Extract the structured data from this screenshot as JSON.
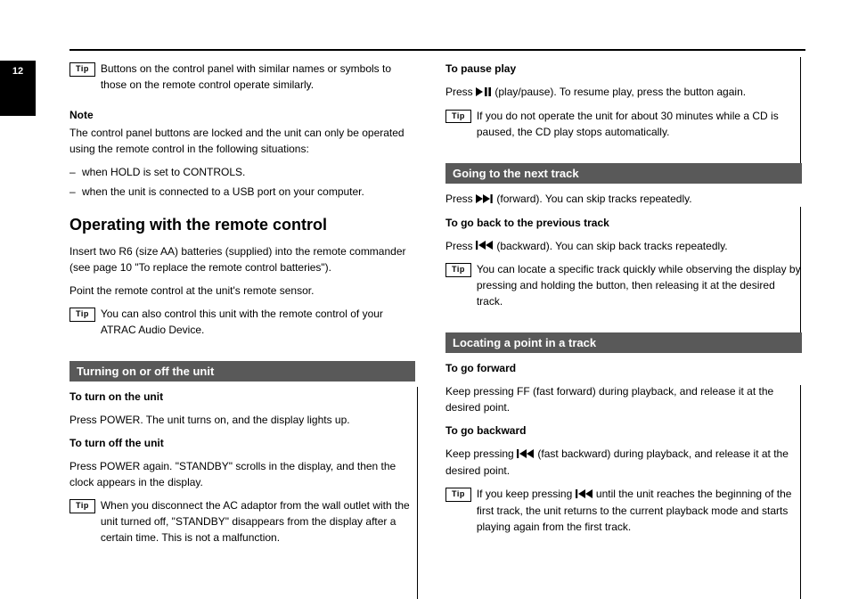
{
  "page_number": "12",
  "left": {
    "tip1": {
      "label": "Tip",
      "body": "Buttons on the control panel with similar names or symbols to those on the remote control operate similarly."
    },
    "note1": {
      "label": "Note",
      "body": "The control panel buttons are locked and the unit can only be operated using the remote control in the following situations:",
      "bullets": [
        "when HOLD is set to CONTROLS.",
        "when the unit is connected to a USB port on your computer."
      ]
    },
    "remote_heading": "Operating with the remote control",
    "remote_p1": "Insert two R6 (size AA) batteries (supplied) into the remote commander (see page 10 \"To replace the remote control batteries\").",
    "remote_p2": "Point the remote control at the unit's remote sensor.",
    "tip2": {
      "label": "Tip",
      "body": "You can also control this unit with the remote control of your ATRAC Audio Device."
    },
    "section_power_title": "Turning on or off the unit",
    "power_on_h": "To turn on the unit",
    "power_on_b": "Press POWER. The unit turns on, and the display lights up.",
    "power_off_h": "To turn off the unit",
    "power_off_b": "Press POWER again. \"STANDBY\" scrolls in the display, and then the clock appears in the display.",
    "tip3": {
      "label": "Tip",
      "body": "When you disconnect the AC adaptor from the wall outlet with the unit turned off, \"STANDBY\" disappears from the display after a certain time. This is not a malfunction."
    }
  },
  "right": {
    "pause_h": "To pause play",
    "pause_b1_pre": "Press ",
    "pause_b1_post": " (play/pause). To resume play, press the button again.",
    "tip_cd": {
      "label": "Tip",
      "body": "If you do not operate the unit for about 30 minutes while a CD is paused, the CD play stops automatically."
    },
    "section_next_title": "Going to the next track",
    "next_b_pre": "Press ",
    "next_b_mid": " (forward). You can skip tracks repeatedly.",
    "prev1_h": "To go back to the previous track",
    "prev1_b_pre": "Press ",
    "prev1_b_post": " (backward). You can skip back tracks repeatedly.",
    "tip_skip": {
      "label": "Tip",
      "body": "You can locate a specific track quickly while observing the display by pressing and holding the button, then releasing it at the desired track."
    },
    "section_locate_title": "Locating a point in a track",
    "fwd_h": "To go forward",
    "fwd_b": "Keep pressing FF (fast forward) during playback, and release it at the desired point.",
    "back_h": "To go backward",
    "back_b_pre": "Keep pressing ",
    "back_b_post": " (fast backward) during playback, and release it at the desired point.",
    "tip_locate": {
      "label": "Tip",
      "body_pre": "If you keep pressing ",
      "body_post": " until the unit reaches the beginning of the first track, the unit returns to the current playback mode and starts playing again from the first track."
    }
  },
  "icons": {
    "play_pause": "play-pause",
    "next": "next",
    "prev": "prev"
  }
}
